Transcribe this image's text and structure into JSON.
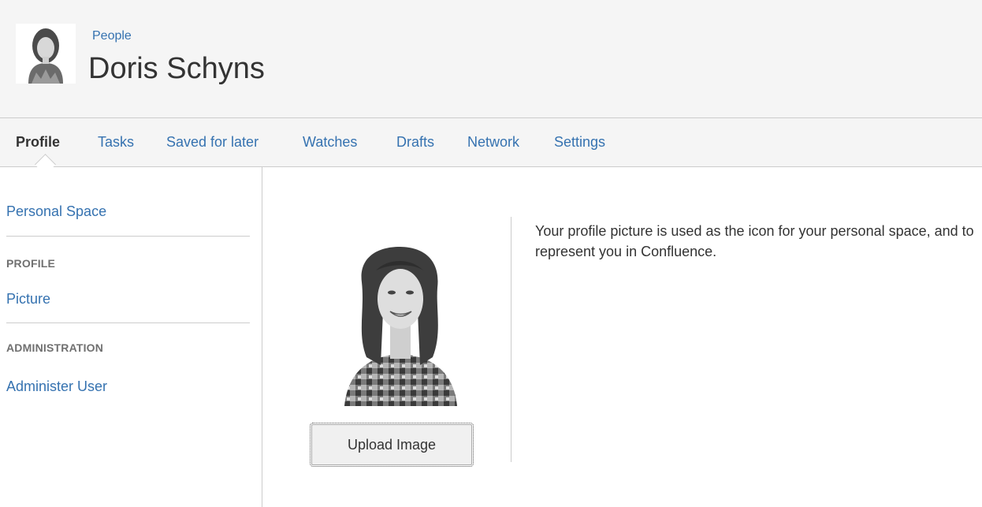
{
  "header": {
    "breadcrumb": "People",
    "title": "Doris Schyns"
  },
  "tabs": [
    {
      "label": "Profile",
      "active": true
    },
    {
      "label": "Tasks",
      "active": false
    },
    {
      "label": "Saved for later",
      "active": false
    },
    {
      "label": "Watches",
      "active": false
    },
    {
      "label": "Drafts",
      "active": false
    },
    {
      "label": "Network",
      "active": false
    },
    {
      "label": "Settings",
      "active": false
    }
  ],
  "sidebar": {
    "personal_space": "Personal Space",
    "profile_heading": "PROFILE",
    "picture": "Picture",
    "admin_heading": "ADMINISTRATION",
    "administer_user": "Administer User"
  },
  "main": {
    "upload_button": "Upload Image",
    "description": "Your profile picture is used as the icon for your personal space, and to represent you in Confluence."
  },
  "colors": {
    "link": "#3572b0",
    "header_bg": "#f5f5f5",
    "border": "#cccccc",
    "text": "#333333"
  }
}
